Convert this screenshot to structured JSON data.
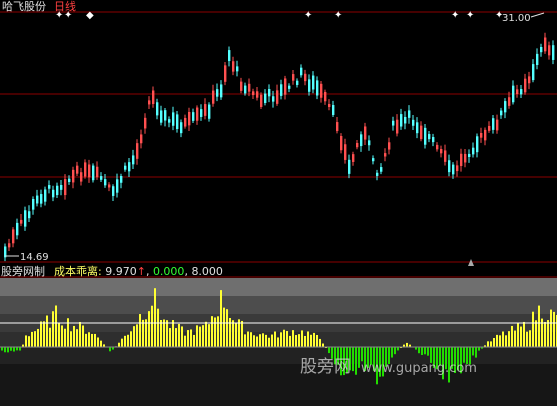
{
  "header": {
    "stock_name": "哈飞股份",
    "period": "日线"
  },
  "price_panel": {
    "high_label": "31.00",
    "low_label": "14.69",
    "bands": [
      {
        "min": 14.69,
        "max": 31.0
      }
    ]
  },
  "indicator": {
    "name": "股旁网制",
    "title": "成本乖离:",
    "value1": "9.970",
    "arrow": "↑",
    "value2": "0.000",
    "value3": "8.000"
  },
  "watermark": {
    "brand": "股旁网",
    "site": "www.gupang.com"
  },
  "colors": {
    "background": "#000000",
    "up": "#ff5050",
    "down": "#54ffff",
    "grid": "#8b0000",
    "hist_pos": "#ffff33",
    "hist_neg": "#22dd00",
    "marker": "#ffffff"
  }
}
